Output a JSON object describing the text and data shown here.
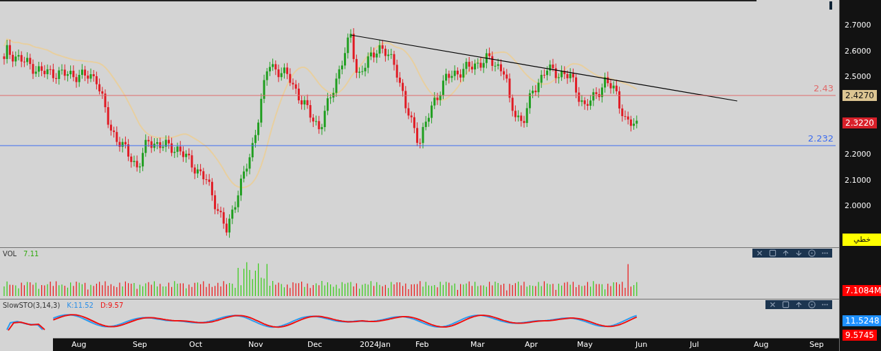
{
  "price_axis": {
    "ticks": [
      "2.7000",
      "2.6000",
      "2.5000",
      "2.2000",
      "2.1000",
      "2.0000"
    ]
  },
  "price_badges": [
    {
      "text": "2.4270",
      "kind": "average"
    },
    {
      "text": "2.3220",
      "kind": "last"
    }
  ],
  "levels": [
    {
      "label": "2.43",
      "color": "#e06a6a"
    },
    {
      "label": "2.232",
      "color": "#3d6cf0"
    }
  ],
  "mode_label": "خطي",
  "volume_pane": {
    "title": "VOL",
    "value": "7.11",
    "badge": "7.1084M",
    "can_move_down": true
  },
  "sto_pane": {
    "title": "SlowSTO(3,14,3)",
    "k": "K:11.52",
    "d": "D:9.57",
    "k_badge": "11.5248",
    "d_badge": "9.5745",
    "can_move_down": false
  },
  "time_axis": [
    "Aug",
    "Sep",
    "Oct",
    "Nov",
    "Dec",
    "2024Jan",
    "Feb",
    "Mar",
    "Apr",
    "May",
    "Jun",
    "Jul",
    "Aug",
    "Sep"
  ]
}
